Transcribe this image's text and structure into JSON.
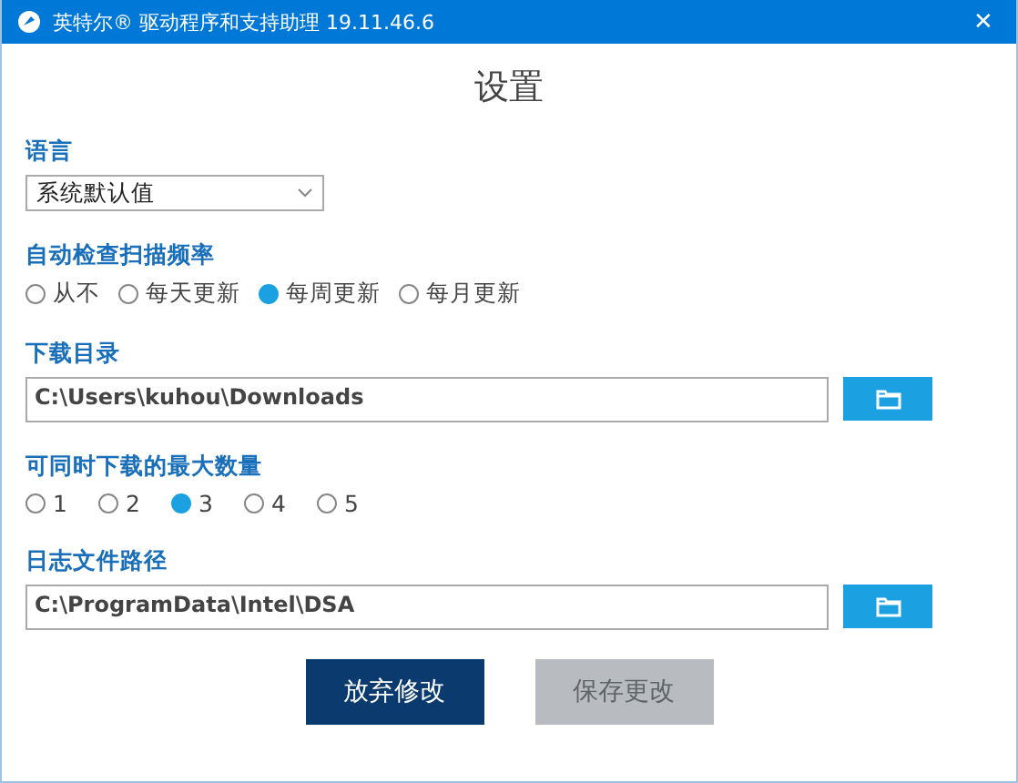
{
  "window": {
    "title": "英特尔® 驱动程序和支持助理 19.11.46.6",
    "close": "✕"
  },
  "heading": "设置",
  "language": {
    "label": "语言",
    "value": "系统默认值"
  },
  "scan_frequency": {
    "label": "自动检查扫描频率",
    "options": [
      {
        "label": "从不",
        "selected": false
      },
      {
        "label": "每天更新",
        "selected": false
      },
      {
        "label": "每周更新",
        "selected": true
      },
      {
        "label": "每月更新",
        "selected": false
      }
    ]
  },
  "download_folder": {
    "label": "下载目录",
    "value": "C:\\Users\\kuhou\\Downloads"
  },
  "max_downloads": {
    "label": "可同时下载的最大数量",
    "options": [
      {
        "label": "1",
        "selected": false
      },
      {
        "label": "2",
        "selected": false
      },
      {
        "label": "3",
        "selected": true
      },
      {
        "label": "4",
        "selected": false
      },
      {
        "label": "5",
        "selected": false
      }
    ]
  },
  "log_path": {
    "label": "日志文件路径",
    "value": "C:\\ProgramData\\Intel\\DSA"
  },
  "buttons": [
    {
      "label": "放弃修改",
      "disabled": false
    },
    {
      "label": "保存更改",
      "disabled": true
    }
  ]
}
